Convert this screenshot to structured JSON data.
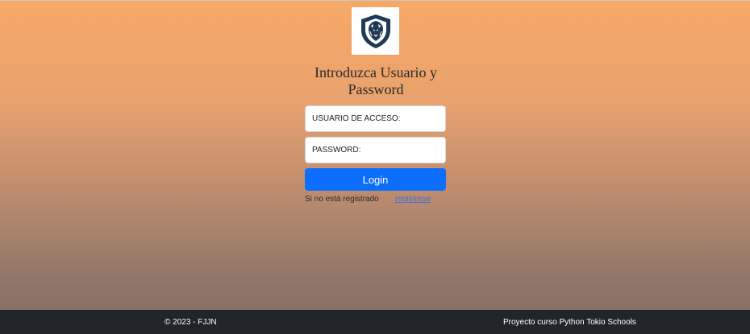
{
  "logo": {
    "icon": "lion-head-shield-icon",
    "accent": "#1f3a55"
  },
  "login": {
    "title": "Introduzca Usuario y Password",
    "user_placeholder": "USUARIO DE ACCESO:",
    "password_placeholder": "PASSWORD:",
    "login_label": "Login",
    "register_prompt": "Si no está registrado",
    "register_link": "registrese"
  },
  "footer": {
    "copyright": "© 2023 - FJJN",
    "project": "Proyecto curso Python Tokio Schools"
  },
  "colors": {
    "primary_button": "#0d6efd",
    "footer_bg": "#212529",
    "gradient_top": "#f7a866",
    "gradient_bottom": "#857060"
  }
}
